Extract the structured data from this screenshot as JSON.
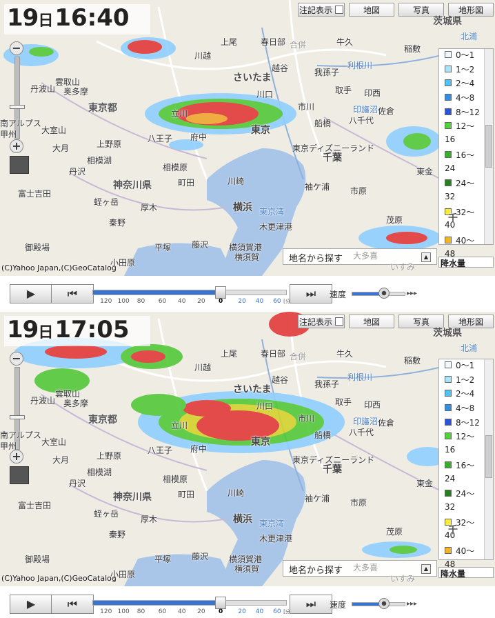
{
  "colors": {
    "map_bg": "#efece4",
    "sea": "#a9c5e8",
    "rain_light": "#8fd0ff",
    "rain_blue": "#3a8fe0",
    "rain_green": "#53c83a",
    "rain_yellow": "#f5d42c",
    "rain_red": "#e23a3a",
    "accent": "#3a73d0"
  },
  "panels": [
    {
      "time": {
        "day": "19",
        "day_unit": "日",
        "clock": "16:40"
      },
      "slider_value": 0
    },
    {
      "time": {
        "day": "19",
        "day_unit": "日",
        "clock": "17:05"
      },
      "slider_value": 0
    }
  ],
  "tabs": {
    "labels": "注記表示",
    "map": "地図",
    "photo": "写真",
    "terrain": "地形図"
  },
  "zoom": {
    "plus": "+",
    "minus": "−"
  },
  "legend": {
    "title": "降水量",
    "items": [
      {
        "label": "0～1",
        "color": "#f0f8ff"
      },
      {
        "label": "1～2",
        "color": "#a7e6f8"
      },
      {
        "label": "2～4",
        "color": "#4fc3f5"
      },
      {
        "label": "4～8",
        "color": "#2f8fe8"
      },
      {
        "label": "8～12",
        "color": "#2a55d9"
      },
      {
        "label": "12～",
        "color": "#4fd23a"
      },
      {
        "label": "16",
        "color": ""
      },
      {
        "label": "16～",
        "color": "#36b02c"
      },
      {
        "label": "24",
        "color": ""
      },
      {
        "label": "24～",
        "color": "#23821d"
      },
      {
        "label": "32",
        "color": ""
      },
      {
        "label": "32～",
        "color": "#f8ee3a"
      },
      {
        "label": "40",
        "color": ""
      },
      {
        "label": "40～",
        "color": "#f3b526"
      },
      {
        "label": "48",
        "color": ""
      }
    ]
  },
  "search": {
    "label": "地名から探す"
  },
  "copyright": "(C)Yahoo Japan,(C)GeoCatalog",
  "playback": {
    "play": "▶",
    "step_back": "⏮",
    "step_forward": "⏭",
    "speed_label": "速度",
    "speed_arrows": "▸▸▸",
    "speed_value": 0.6,
    "ticks": [
      "120",
      "100",
      "80",
      "60",
      "40",
      "20",
      "0",
      "20",
      "40",
      "60"
    ],
    "tick_unit": "[分]"
  },
  "places": [
    {
      "name": "茨城県",
      "cls": "pref"
    },
    {
      "name": "北浦",
      "cls": "water"
    },
    {
      "name": "牛久",
      "cls": ""
    },
    {
      "name": "稲敷",
      "cls": ""
    },
    {
      "name": "上尾",
      "cls": ""
    },
    {
      "name": "春日部",
      "cls": ""
    },
    {
      "name": "合併",
      "cls": "dim"
    },
    {
      "name": "川越",
      "cls": ""
    },
    {
      "name": "さいたま",
      "cls": "big"
    },
    {
      "name": "越谷",
      "cls": ""
    },
    {
      "name": "取手",
      "cls": ""
    },
    {
      "name": "利根川",
      "cls": "water"
    },
    {
      "name": "我孫子",
      "cls": ""
    },
    {
      "name": "川口",
      "cls": ""
    },
    {
      "name": "印西",
      "cls": ""
    },
    {
      "name": "市川",
      "cls": ""
    },
    {
      "name": "船橋",
      "cls": ""
    },
    {
      "name": "八千代",
      "cls": ""
    },
    {
      "name": "佐倉",
      "cls": ""
    },
    {
      "name": "印旛沼",
      "cls": "water"
    },
    {
      "name": "東京都",
      "cls": "pref"
    },
    {
      "name": "立川",
      "cls": ""
    },
    {
      "name": "東京",
      "cls": "big"
    },
    {
      "name": "八王子",
      "cls": ""
    },
    {
      "name": "府中",
      "cls": ""
    },
    {
      "name": "東京ディズニーランド",
      "cls": ""
    },
    {
      "name": "千葉",
      "cls": "big"
    },
    {
      "name": "東金",
      "cls": ""
    },
    {
      "name": "奥多摩",
      "cls": ""
    },
    {
      "name": "雲取山",
      "cls": ""
    },
    {
      "name": "丹波山",
      "cls": ""
    },
    {
      "name": "大月",
      "cls": ""
    },
    {
      "name": "上野原",
      "cls": ""
    },
    {
      "name": "相模湖",
      "cls": ""
    },
    {
      "name": "相模原",
      "cls": ""
    },
    {
      "name": "町田",
      "cls": ""
    },
    {
      "name": "川崎",
      "cls": ""
    },
    {
      "name": "神奈川県",
      "cls": "pref"
    },
    {
      "name": "富士吉田",
      "cls": ""
    },
    {
      "name": "厚木",
      "cls": ""
    },
    {
      "name": "横浜",
      "cls": "big"
    },
    {
      "name": "東京湾",
      "cls": "water"
    },
    {
      "name": "木更津港",
      "cls": ""
    },
    {
      "name": "市原",
      "cls": ""
    },
    {
      "name": "袖ケ浦",
      "cls": ""
    },
    {
      "name": "茂原",
      "cls": ""
    },
    {
      "name": "秦野",
      "cls": ""
    },
    {
      "name": "平塚",
      "cls": ""
    },
    {
      "name": "藤沢",
      "cls": ""
    },
    {
      "name": "横須賀港",
      "cls": ""
    },
    {
      "name": "横須賀",
      "cls": ""
    },
    {
      "name": "小田原",
      "cls": ""
    },
    {
      "name": "御殿場",
      "cls": ""
    },
    {
      "name": "大多喜",
      "cls": "dim"
    },
    {
      "name": "いすみ",
      "cls": "dim"
    },
    {
      "name": "南アルプス",
      "cls": ""
    },
    {
      "name": "甲州",
      "cls": ""
    },
    {
      "name": "大室山",
      "cls": ""
    },
    {
      "name": "丹沢",
      "cls": ""
    },
    {
      "name": "蛭ヶ岳",
      "cls": ""
    },
    {
      "name": "千",
      "cls": "pref"
    }
  ]
}
